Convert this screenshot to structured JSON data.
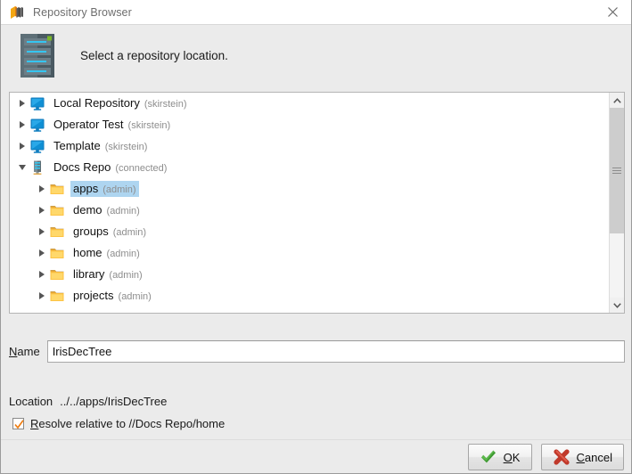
{
  "window": {
    "title": "Repository Browser",
    "icon": "repository-cube-icon",
    "close_icon": "close-icon"
  },
  "header": {
    "icon": "server-rack-icon",
    "message": "Select a repository location."
  },
  "tree": {
    "nodes": [
      {
        "label": "Local Repository",
        "sub": "(skirstein)",
        "icon": "monitor-icon",
        "expanded": false,
        "indent": 0,
        "selected": false
      },
      {
        "label": "Operator Test",
        "sub": "(skirstein)",
        "icon": "monitor-icon",
        "expanded": false,
        "indent": 0,
        "selected": false
      },
      {
        "label": "Template",
        "sub": "(skirstein)",
        "icon": "monitor-icon",
        "expanded": false,
        "indent": 0,
        "selected": false
      },
      {
        "label": "Docs Repo",
        "sub": "(connected)",
        "icon": "server-icon",
        "expanded": true,
        "indent": 0,
        "selected": false
      },
      {
        "label": "apps",
        "sub": "(admin)",
        "icon": "folder-icon",
        "expanded": false,
        "indent": 1,
        "selected": true
      },
      {
        "label": "demo",
        "sub": "(admin)",
        "icon": "folder-icon",
        "expanded": false,
        "indent": 1,
        "selected": false
      },
      {
        "label": "groups",
        "sub": "(admin)",
        "icon": "folder-icon",
        "expanded": false,
        "indent": 1,
        "selected": false
      },
      {
        "label": "home",
        "sub": "(admin)",
        "icon": "folder-icon",
        "expanded": false,
        "indent": 1,
        "selected": false
      },
      {
        "label": "library",
        "sub": "(admin)",
        "icon": "folder-icon",
        "expanded": false,
        "indent": 1,
        "selected": false
      },
      {
        "label": "projects",
        "sub": "(admin)",
        "icon": "folder-icon",
        "expanded": false,
        "indent": 1,
        "selected": false
      }
    ]
  },
  "scrollbar": {
    "up_icon": "chevron-up-icon",
    "down_icon": "chevron-down-icon",
    "grip_icon": "grip-lines-icon"
  },
  "name_field": {
    "label_prefix": "N",
    "label_rest": "ame",
    "value": "IrisDecTree",
    "placeholder": ""
  },
  "location": {
    "label": "Location",
    "value": "../../apps/IrisDecTree"
  },
  "resolve": {
    "checked": true,
    "label_prefix": "R",
    "label_rest": "esolve relative to //Docs Repo/home",
    "check_icon": "checkmark-icon"
  },
  "buttons": {
    "ok": {
      "prefix": "O",
      "rest": "K",
      "icon": "green-check-icon"
    },
    "cancel": {
      "prefix": "C",
      "rest": "ancel",
      "icon": "red-x-icon"
    }
  },
  "colors": {
    "selection": "#aed5f0",
    "accent_orange": "#f08018",
    "ok_green": "#3f9a32",
    "cancel_red": "#c0392b",
    "panel_bg": "#ebebeb"
  }
}
